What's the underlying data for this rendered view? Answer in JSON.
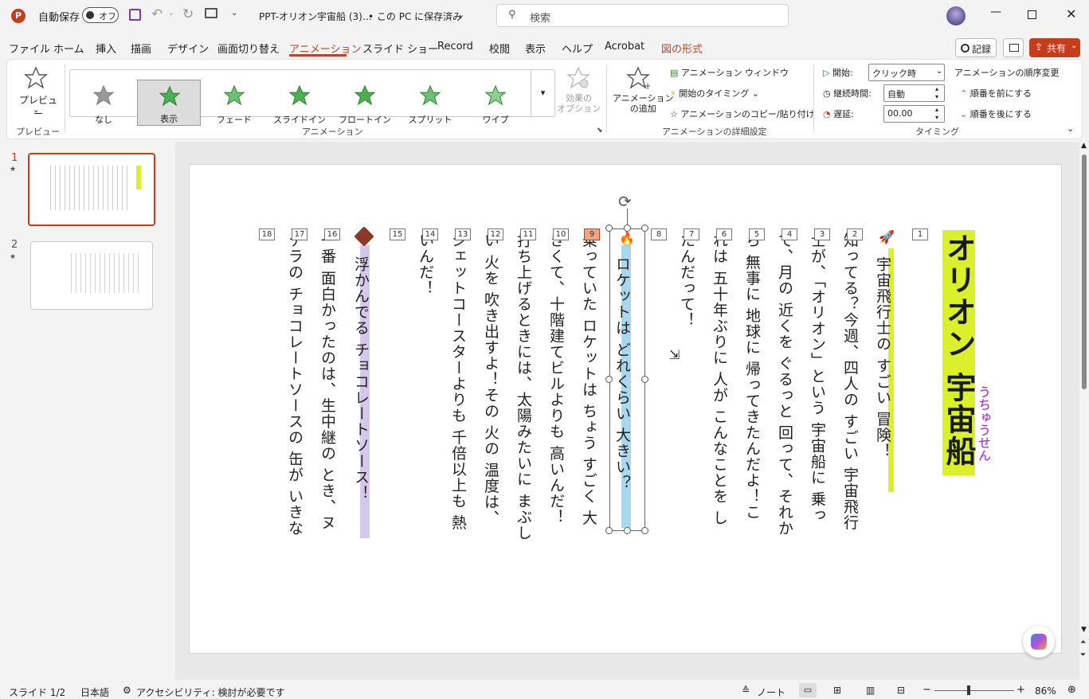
{
  "titlebar": {
    "autosave_label": "自動保存",
    "autosave_state": "オフ",
    "doc_title": "PPT-オリオン宇宙船 (3)…",
    "save_status": "• この PC に保存済み",
    "search_placeholder": "検索"
  },
  "tabs": [
    "ファイル",
    "ホーム",
    "挿入",
    "描画",
    "デザイン",
    "画面切り替え",
    "アニメーション",
    "スライド ショー",
    "Record",
    "校閲",
    "表示",
    "ヘルプ",
    "Acrobat",
    "図の形式"
  ],
  "right_buttons": {
    "record": "記録",
    "share": "共有"
  },
  "ribbon": {
    "preview_label": "プレビュー",
    "preview_group": "プレビュー",
    "gallery": [
      "なし",
      "表示",
      "フェード",
      "スライドイン",
      "フロートイン",
      "スプリット",
      "ワイプ"
    ],
    "effect_options": "効果の\nオプション",
    "animation_group": "アニメーション",
    "add_animation": "アニメーション\nの追加",
    "animation_window": "アニメーション ウィンドウ",
    "trigger": "開始のタイミング",
    "copy_paste": "アニメーションのコピー/貼り付け",
    "advanced_group": "アニメーションの詳細設定",
    "start_label": "開始:",
    "start_value": "クリック時",
    "duration_label": "継続時間:",
    "duration_value": "自動",
    "delay_label": "遅延:",
    "delay_value": "00.00",
    "timing_group": "タイミング",
    "reorder_title": "アニメーションの順序変更",
    "move_earlier": "順番を前にする",
    "move_later": "順番を後にする"
  },
  "slides": [
    {
      "number": "1",
      "star": "★"
    },
    {
      "number": "2",
      "star": "★"
    }
  ],
  "slide_content": {
    "title": "オリオン 宇宙船",
    "title_ruby": "うちゅうせん",
    "markers": [
      "1",
      "2",
      "3",
      "4",
      "5",
      "6",
      "7",
      "8",
      "9",
      "10",
      "11",
      "12",
      "13",
      "14",
      "15",
      "16",
      "17",
      "18"
    ],
    "columns": [
      "宇宙飛行士の すごい 冒険！",
      "知ってる？今週、四人の すごい 宇宙飛行",
      "士が、「オリオン」という 宇宙船に 乗っ",
      "て、月の 近くを ぐるっと 回って、それか",
      "ら 無事に 地球に 帰ってきたんだよ！こ",
      "れは 五十年ぶりに 人が こんなことを し",
      "たんだって！",
      "",
      "ロケットは どれくらい 大きい？",
      "乗っていた ロケットは ちょう すごく 大",
      "きくて、十階建てビルよりも 高いんだ！",
      "打ち上げるときには、太陽みたいに まぶし",
      "い 火を 吹き出すよ！その 火の 温度は、",
      "ジェットコースターよりも 千倍以上も 熱",
      "いんだ！",
      "",
      "浮かんでる チョコレートソース！",
      "一番 面白かったのは、生中継の とき、ヌ",
      "テラの チョコレートソースの 缶が いきな"
    ]
  },
  "status": {
    "slide": "スライド 1/2",
    "language": "日本語",
    "accessibility": "アクセシビリティ: 検討が必要です",
    "notes": "ノート",
    "zoom": "86%"
  }
}
